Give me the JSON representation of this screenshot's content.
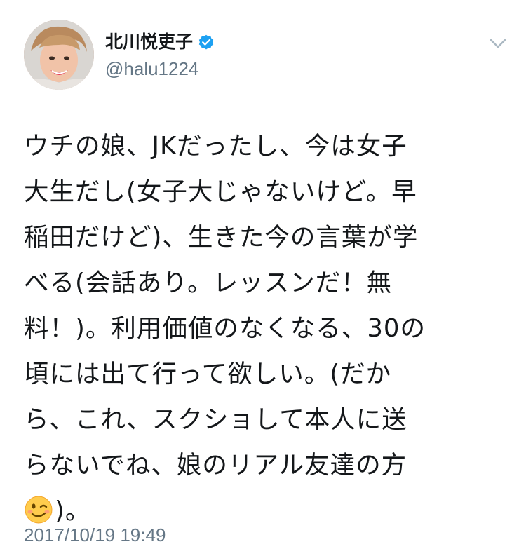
{
  "tweet": {
    "author": {
      "display_name": "北川悦吏子",
      "handle": "@halu1224",
      "verified": true,
      "avatar_icon": "avatar-photo"
    },
    "menu_icon": "chevron-down-icon",
    "text_lines": [
      "ウチの娘、JKだったし、今は女子",
      "大生だし(女子大じゃないけど。早",
      "稲田だけど)、生きた今の言葉が学",
      "べる(会話あり。レッスンだ！無",
      "料！)。利用価値のなくなる、30の",
      "頃には出て行って欲しい。(だか",
      "ら、これ、スクショして本人に送",
      "らないでね、娘のリアル友達の方"
    ],
    "last_line_emoji": "winking-face-emoji",
    "last_line_text": ")。",
    "timestamp": "2017/10/19 19:49"
  },
  "colors": {
    "text": "#14171a",
    "secondary": "#657786",
    "verified": "#1da1f2",
    "background": "#ffffff"
  }
}
